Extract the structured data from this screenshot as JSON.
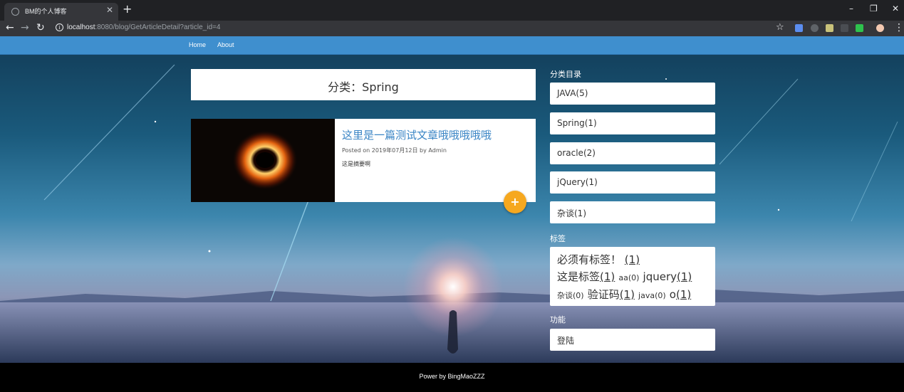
{
  "browser": {
    "tab_title": "BM的个人博客",
    "tab_close": "✕",
    "new_tab": "+",
    "url_host": "localhost",
    "url_rest": ":8080/blog/GetArticleDetail?article_id=4",
    "win_minimize": "–",
    "win_restore": "❐",
    "win_close": "✕"
  },
  "navbar": {
    "home": "Home",
    "about": "About"
  },
  "main": {
    "category_heading": "分类：Spring",
    "article": {
      "title": "这里是一篇测试文章哦哦哦哦哦",
      "meta": "Posted on 2019年07月12日 by Admin",
      "summary": "这是摘要啊",
      "fab": "+"
    }
  },
  "sidebar": {
    "categories_label": "分类目录",
    "categories": [
      "JAVA(5)",
      "Spring(1)",
      "oracle(2)",
      "jQuery(1)",
      "杂谈(1)"
    ],
    "tags_label": "标签",
    "tags": [
      {
        "name": "必须有标签！",
        "count": "(1)"
      },
      {
        "name": "这是标签",
        "count": "(1)"
      },
      {
        "name": "aa",
        "count": "(0)"
      },
      {
        "name": "jquery",
        "count": "(1)"
      },
      {
        "name": "杂谈",
        "count": "(0)"
      },
      {
        "name": "验证码",
        "count": "(1)"
      },
      {
        "name": "java",
        "count": "(0)"
      },
      {
        "name": "o",
        "count": "(1)"
      }
    ],
    "functions_label": "功能",
    "login": "登陆"
  },
  "footer": {
    "text": "Power by BingMaoZZZ"
  },
  "colors": {
    "navbar": "#3f8fce",
    "article_title": "#3a85c5",
    "fab": "#f6a81f"
  }
}
